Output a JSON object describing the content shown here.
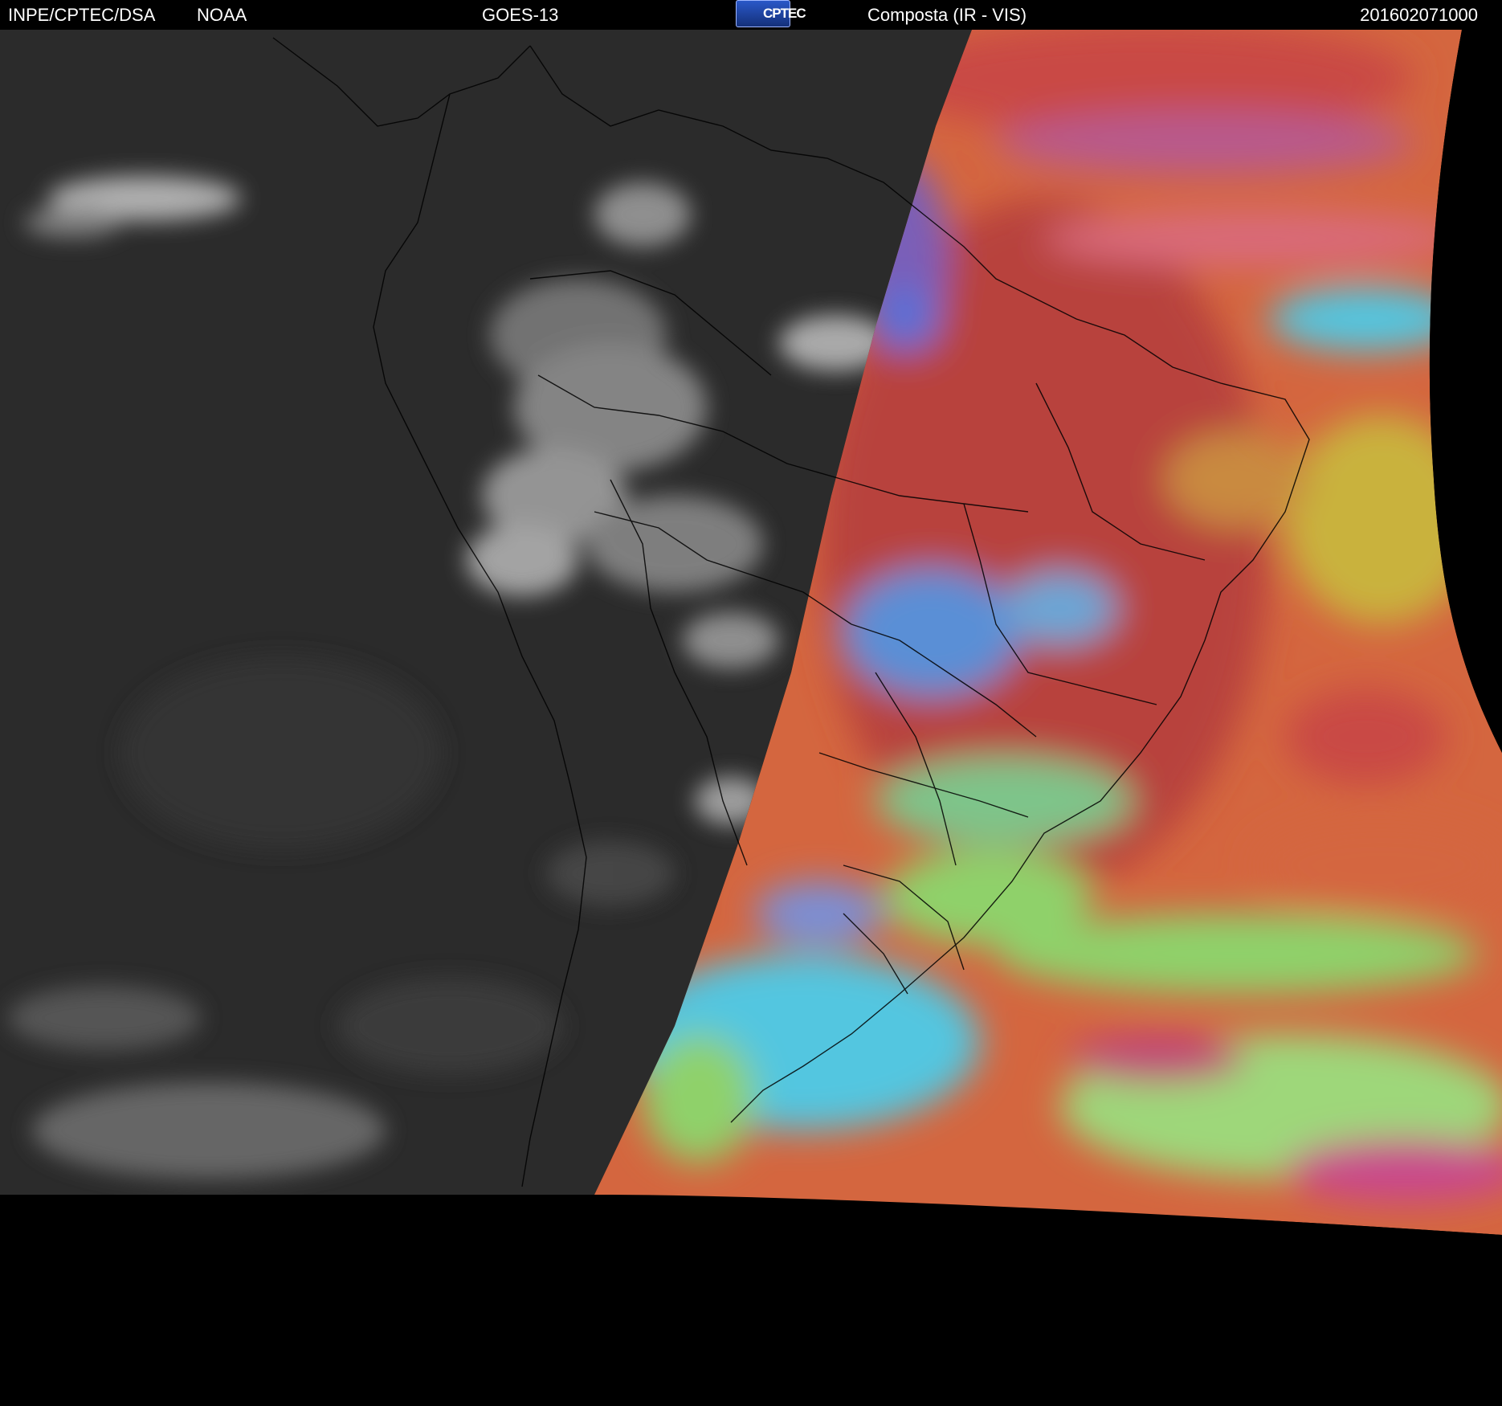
{
  "header": {
    "organization": "INPE/CPTEC/DSA",
    "agency": "NOAA",
    "satellite": "GOES-13",
    "logo_text": "CPTEC",
    "product": "Composta (IR - VIS)",
    "timestamp": "201602071000"
  },
  "colors": {
    "background": "#000000",
    "header_text": "#ffffff",
    "ir_dark": "#2b2b2b",
    "ir_cloud": "#cfcfcf",
    "composite_land_red": "#b8433c",
    "composite_ocean_orange": "#d4663f",
    "composite_yellow": "#c9b23d",
    "composite_cyan": "#52c6e0",
    "composite_green": "#8fd16a",
    "composite_blue": "#5a6fd6",
    "border_lines": "#000000"
  },
  "map": {
    "icons": [
      "cptec-logo"
    ]
  }
}
